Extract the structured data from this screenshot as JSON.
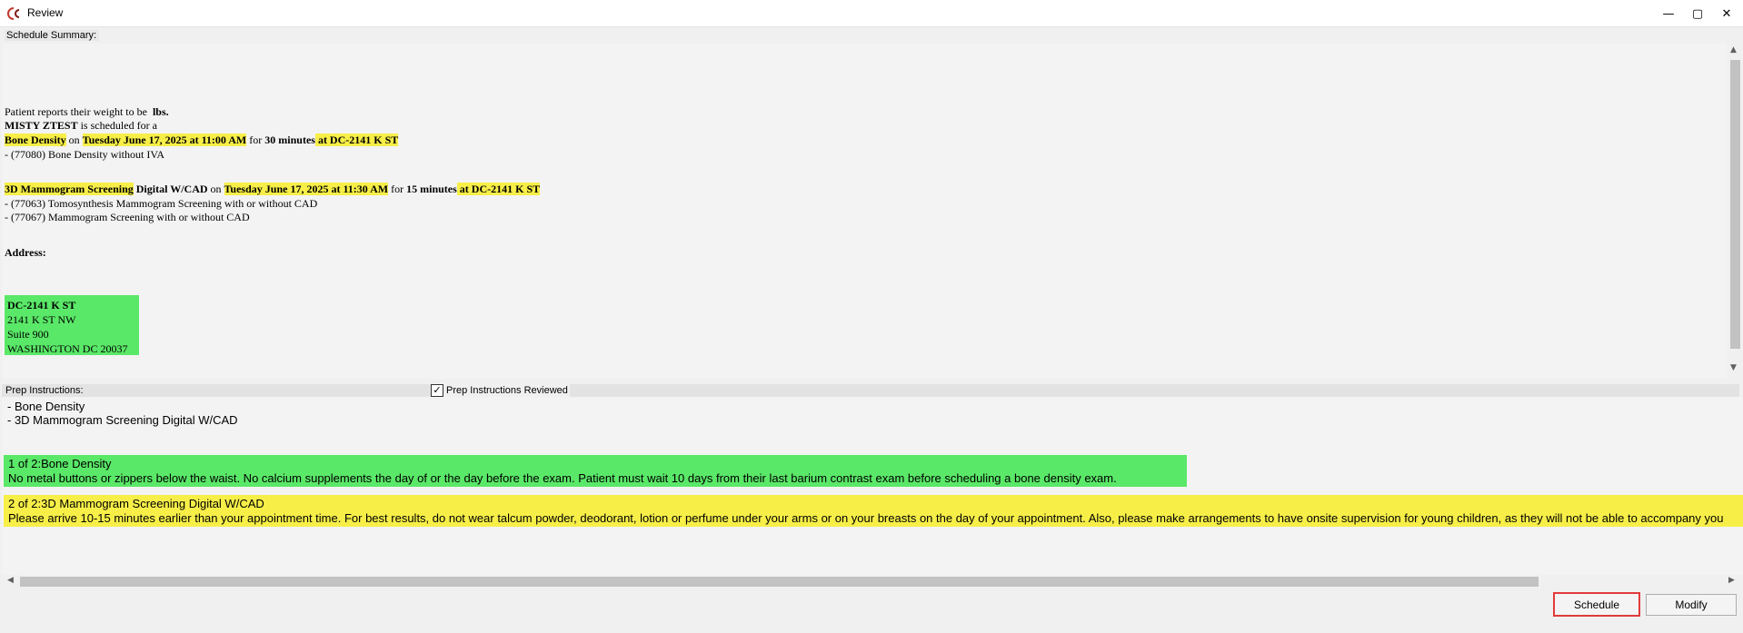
{
  "window": {
    "title": "Review",
    "icon": "cc-app-logo-icon",
    "minimize_glyph": "—",
    "maximize_glyph": "▢",
    "close_glyph": "✕"
  },
  "summary": {
    "label": "Schedule Summary:",
    "weight_line": "Patient reports their weight to be",
    "weight_unit": "lbs.",
    "patient_name": "MISTY ZTEST",
    "scheduled_for": " is scheduled for a",
    "appointments": [
      {
        "exam": "Bone Density",
        "exam_suffix": "",
        "on": " on ",
        "datetime": "Tuesday June 17, 2025 at 11:00 AM",
        "for": " for ",
        "duration": "30 minutes",
        "location": " at DC-2141 K ST ",
        "codes": [
          " - (77080) Bone Density without IVA"
        ]
      },
      {
        "exam": "3D Mammogram Screening",
        "exam_suffix": " Digital W/CAD",
        "on": " on ",
        "datetime": "Tuesday June 17, 2025 at 11:30 AM",
        "for": " for ",
        "duration": "15 minutes",
        "location": " at DC-2141 K ST ",
        "codes": [
          " - (77063) Tomosynthesis Mammogram Screening with or without CAD",
          " - (77067) Mammogram Screening with or without CAD"
        ]
      }
    ],
    "address_label": "Address:",
    "address": {
      "name": "DC-2141 K ST",
      "street": "2141 K ST NW",
      "suite": "Suite 900",
      "city": "WASHINGTON DC 20037"
    }
  },
  "prep": {
    "label": "Prep Instructions:",
    "reviewed_label": "Prep Instructions Reviewed",
    "reviewed_checked": true,
    "check_glyph": "✓",
    "exam_list": [
      "- Bone Density",
      "- 3D Mammogram Screening Digital W/CAD"
    ],
    "instructions": [
      {
        "heading": "1 of 2:Bone Density",
        "text": "No metal buttons or zippers below the  waist.  No calcium supplements the  day of or the  day  before the exam.  Patient  must  wait  10 days  from their  last barium  contrast exam before scheduling a  bone density exam.",
        "color": "#5ae868"
      },
      {
        "heading": "2 of 2:3D Mammogram Screening Digital W/CAD",
        "text": "Please arrive  10-15 minutes  earlier than  your appointment time.  For best results,  do not  wear talcum powder,  deodorant,  lotion or  perfume under  your arms  or on  your breasts  on the  day of your  appointment.  Also, please make arrangements  to have  onsite supervision for young children,  as they  will  not be able to accompany you",
        "color": "#f7ef48"
      }
    ]
  },
  "scroll": {
    "up_glyph": "▲",
    "down_glyph": "▼",
    "left_glyph": "◀",
    "right_glyph": "▶"
  },
  "buttons": {
    "schedule": "Schedule",
    "modify": "Modify"
  },
  "colors": {
    "highlight_yellow": "#f7ef48",
    "highlight_green": "#5ae868",
    "focus_border": "#e23a3a"
  }
}
